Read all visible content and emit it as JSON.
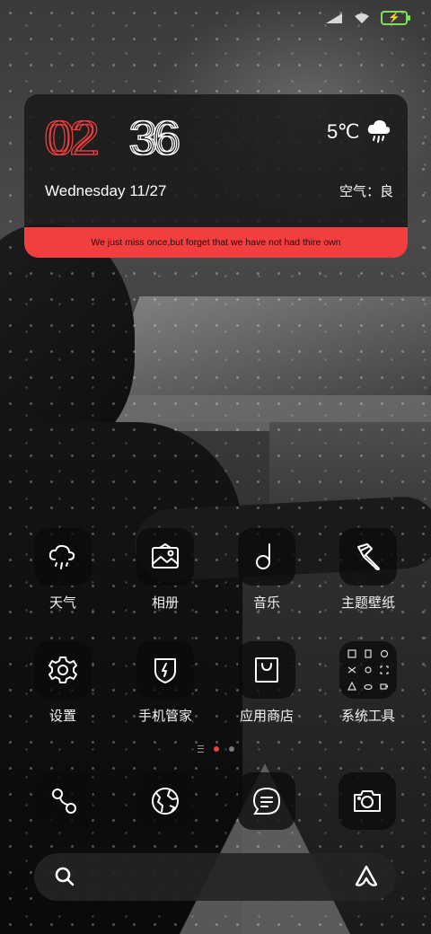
{
  "status": {
    "battery_color": "#7ce05a",
    "icons": [
      "signal-icon",
      "wifi-icon",
      "battery-charging-icon"
    ]
  },
  "widget": {
    "clock": {
      "hours": "02",
      "minutes": "36",
      "hours_color": "#f23e3e",
      "minutes_color": "#ffffff"
    },
    "date": "Wednesday 11/27",
    "temperature": "5℃",
    "weather_icon": "cloud-rain-icon",
    "air_quality": "空气：良",
    "quote": "We just miss once,but forget that we have not had thire own",
    "accent": "#f23e3e"
  },
  "apps": [
    {
      "label": "天气",
      "icon": "weather-icon"
    },
    {
      "label": "相册",
      "icon": "gallery-icon"
    },
    {
      "label": "音乐",
      "icon": "music-icon"
    },
    {
      "label": "主题壁纸",
      "icon": "theme-brush-icon"
    },
    {
      "label": "设置",
      "icon": "settings-gear-icon"
    },
    {
      "label": "手机管家",
      "icon": "security-shield-icon"
    },
    {
      "label": "应用商店",
      "icon": "app-store-bag-icon"
    },
    {
      "label": "系统工具",
      "icon": "system-tools-folder-icon"
    }
  ],
  "pager": {
    "pages": 2,
    "active": 1
  },
  "dock": [
    {
      "icon": "phone-icon"
    },
    {
      "icon": "browser-globe-icon"
    },
    {
      "icon": "messages-icon"
    },
    {
      "icon": "camera-icon"
    }
  ],
  "search": {
    "placeholder": "",
    "left_icon": "search-icon",
    "right_icon": "assistant-icon"
  }
}
